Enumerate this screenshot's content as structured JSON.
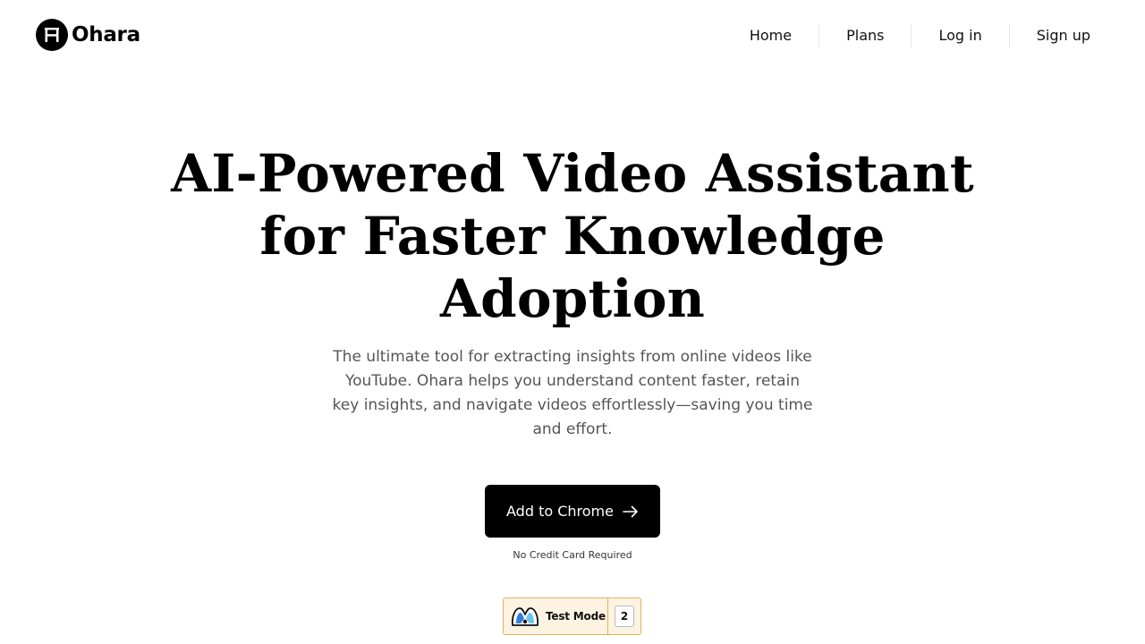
{
  "header": {
    "logo_text": "Ohara",
    "nav": {
      "home": "Home",
      "plans": "Plans",
      "login": "Log in",
      "signup": "Sign up"
    }
  },
  "hero": {
    "title_line1": "AI-Powered Video Assistant",
    "title_line2": "for Faster Knowledge",
    "title_line3": "Adoption",
    "subtitle": "The ultimate tool for extracting insights from online videos like YouTube. Ohara helps you understand content faster, retain key insights, and navigate videos effortlessly—saving you time and effort.",
    "cta_label": "Add to Chrome",
    "note": "No Credit Card Required"
  },
  "test_badge": {
    "label": "Test Mode",
    "count": "2"
  },
  "icons": {
    "logo": "ohara-logo-icon",
    "cta": "arrow-right-icon",
    "badge": "test-mode-logo-icon"
  },
  "colors": {
    "primary": "#000000",
    "text_muted": "#555555",
    "badge_bg": "#fdf3e2",
    "badge_border": "#e9b15a"
  }
}
